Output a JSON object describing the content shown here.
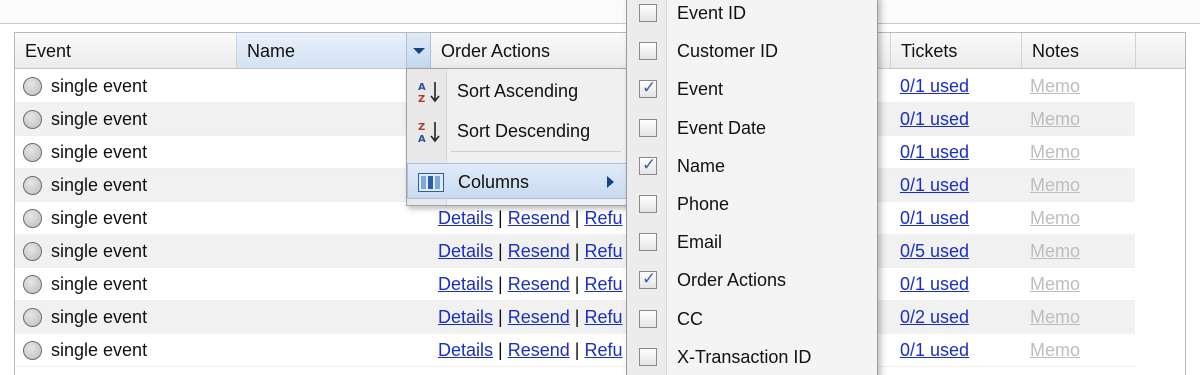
{
  "columns": {
    "event": "Event",
    "name": "Name",
    "order_actions": "Order Actions",
    "tickets": "Tickets",
    "notes": "Notes"
  },
  "rows": [
    {
      "event": "single event",
      "tickets": "0/1 used",
      "notes": "Memo",
      "actions_visible": false
    },
    {
      "event": "single event",
      "tickets": "0/1 used",
      "notes": "Memo",
      "actions_visible": false
    },
    {
      "event": "single event",
      "tickets": "0/1 used",
      "notes": "Memo",
      "actions_visible": false
    },
    {
      "event": "single event",
      "tickets": "0/1 used",
      "notes": "Memo",
      "actions_visible": false
    },
    {
      "event": "single event",
      "details": "Details",
      "resend": "Resend",
      "refund": "Refu",
      "tickets": "0/1 used",
      "notes": "Memo"
    },
    {
      "event": "single event",
      "details": "Details",
      "resend": "Resend",
      "refund": "Refu",
      "tickets": "0/5 used",
      "notes": "Memo"
    },
    {
      "event": "single event",
      "details": "Details",
      "resend": "Resend",
      "refund": "Refu",
      "tickets": "0/1 used",
      "notes": "Memo"
    },
    {
      "event": "single event",
      "details": "Details",
      "resend": "Resend",
      "refund": "Refu",
      "tickets": "0/2 used",
      "notes": "Memo"
    },
    {
      "event": "single event",
      "details": "Details",
      "resend": "Resend",
      "refund": "Refu",
      "tickets": "0/1 used",
      "notes": "Memo"
    }
  ],
  "header_menu": {
    "sort_ascending": "Sort Ascending",
    "sort_descending": "Sort Descending",
    "columns": "Columns"
  },
  "columns_menu": [
    {
      "label": "Event ID",
      "checked": false
    },
    {
      "label": "Customer ID",
      "checked": false
    },
    {
      "label": "Event",
      "checked": true
    },
    {
      "label": "Event Date",
      "checked": false
    },
    {
      "label": "Name",
      "checked": true
    },
    {
      "label": "Phone",
      "checked": false
    },
    {
      "label": "Email",
      "checked": false
    },
    {
      "label": "Order Actions",
      "checked": true
    },
    {
      "label": "CC",
      "checked": false
    },
    {
      "label": "X-Transaction ID",
      "checked": false
    }
  ],
  "icons": {
    "sort_asc": "sort-ascending-icon",
    "sort_desc": "sort-descending-icon",
    "columns": "columns-icon",
    "submenu_arrow": "chevron-right-icon",
    "header_trigger": "chevron-down-icon"
  },
  "colors": {
    "link": "#1a2fbf",
    "memo": "#bdbdbd",
    "active_header": "#d3e2f4",
    "checkmark": "#3a5fae"
  }
}
